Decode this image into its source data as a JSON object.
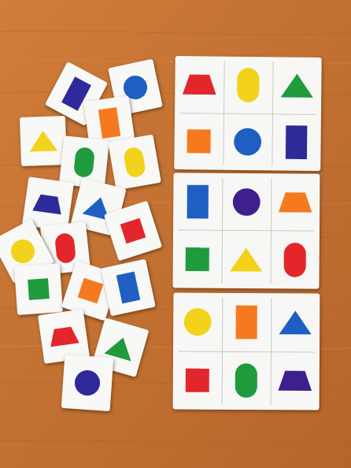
{
  "colors": {
    "red": "#e3262b",
    "yellow": "#f2d21a",
    "green": "#1f9a3c",
    "blue": "#1f5fc4",
    "indigo": "#2e2a9a",
    "purple": "#3d1f8e",
    "orange": "#f57a1f",
    "table": "#c57433",
    "card": "#f8f8f6"
  },
  "boards": [
    {
      "cells": [
        {
          "shape": "trapezoid",
          "color": "red"
        },
        {
          "shape": "oval",
          "color": "yellow"
        },
        {
          "shape": "triangle",
          "color": "green"
        },
        {
          "shape": "square",
          "color": "orange"
        },
        {
          "shape": "circle",
          "color": "blue"
        },
        {
          "shape": "rectangle",
          "color": "indigo"
        }
      ]
    },
    {
      "cells": [
        {
          "shape": "rectangle",
          "color": "blue"
        },
        {
          "shape": "circle",
          "color": "purple"
        },
        {
          "shape": "trapezoid",
          "color": "orange"
        },
        {
          "shape": "square",
          "color": "green"
        },
        {
          "shape": "triangle",
          "color": "yellow"
        },
        {
          "shape": "oval",
          "color": "red"
        }
      ]
    },
    {
      "cells": [
        {
          "shape": "circle",
          "color": "yellow"
        },
        {
          "shape": "rectangle",
          "color": "orange"
        },
        {
          "shape": "triangle",
          "color": "blue"
        },
        {
          "shape": "square",
          "color": "red"
        },
        {
          "shape": "oval",
          "color": "green"
        },
        {
          "shape": "trapezoid",
          "color": "purple"
        }
      ]
    }
  ],
  "loose_cards": [
    {
      "shape": "circle",
      "color": "blue"
    },
    {
      "shape": "rectangle",
      "color": "indigo"
    },
    {
      "shape": "rectangle",
      "color": "orange"
    },
    {
      "shape": "triangle",
      "color": "yellow"
    },
    {
      "shape": "oval",
      "color": "green"
    },
    {
      "shape": "oval",
      "color": "yellow"
    },
    {
      "shape": "trapezoid",
      "color": "indigo"
    },
    {
      "shape": "triangle",
      "color": "blue"
    },
    {
      "shape": "square",
      "color": "red"
    },
    {
      "shape": "oval",
      "color": "red"
    },
    {
      "shape": "circle",
      "color": "yellow"
    },
    {
      "shape": "square",
      "color": "green"
    },
    {
      "shape": "square",
      "color": "orange"
    },
    {
      "shape": "rectangle",
      "color": "blue"
    },
    {
      "shape": "trapezoid",
      "color": "red"
    },
    {
      "shape": "triangle",
      "color": "green"
    },
    {
      "shape": "circle",
      "color": "indigo"
    }
  ]
}
